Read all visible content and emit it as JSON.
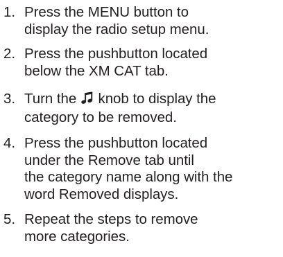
{
  "steps": [
    {
      "number": "1.",
      "lines": [
        "Press the MENU button to",
        "display the radio setup menu."
      ]
    },
    {
      "number": "2.",
      "lines": [
        "Press the pushbutton located",
        "below the XM CAT tab."
      ]
    },
    {
      "number": "3.",
      "line1_before_icon": "Turn the",
      "line1_after_icon": "knob to display the",
      "icon": "music-note-icon",
      "lines": [
        "category to be removed."
      ]
    },
    {
      "number": "4.",
      "lines": [
        "Press the pushbutton located",
        "under the Remove tab until",
        "the category name along with the",
        "word Removed displays."
      ]
    },
    {
      "number": "5.",
      "lines": [
        "Repeat the steps to remove",
        "more categories."
      ]
    }
  ]
}
